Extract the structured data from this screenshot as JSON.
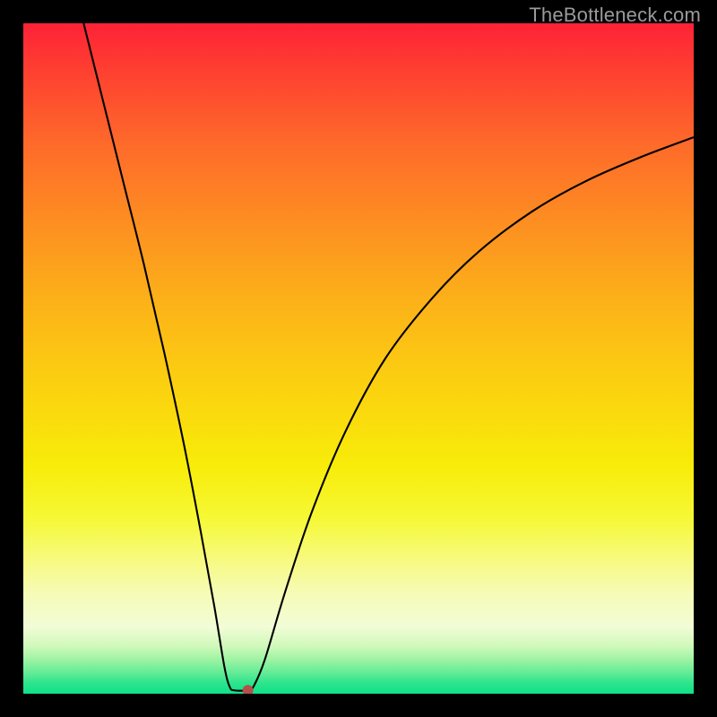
{
  "watermark": "TheBottleneck.com",
  "chart_data": {
    "type": "line",
    "title": "",
    "xlabel": "",
    "ylabel": "",
    "xlim": [
      0,
      100
    ],
    "ylim": [
      0,
      100
    ],
    "series": [
      {
        "name": "curve",
        "x": [
          9,
          12,
          15,
          18,
          21,
          24,
          26.5,
          28.5,
          30,
          30.8,
          31.5,
          33.5,
          34.3,
          36,
          39,
          43,
          48,
          54,
          61,
          68,
          76,
          84,
          92,
          100
        ],
        "y": [
          100,
          88,
          76,
          64,
          51,
          37,
          24,
          13,
          4,
          1,
          0.5,
          0.5,
          1,
          5,
          15,
          27,
          39,
          50,
          59,
          66,
          72,
          76.5,
          80,
          83
        ]
      }
    ],
    "marker": {
      "x": 33.5,
      "y": 0.5
    },
    "colors": {
      "curve": "#000000",
      "marker": "#b54f4a",
      "gradient_top": "#fe2237",
      "gradient_bottom": "#0fe189"
    }
  }
}
